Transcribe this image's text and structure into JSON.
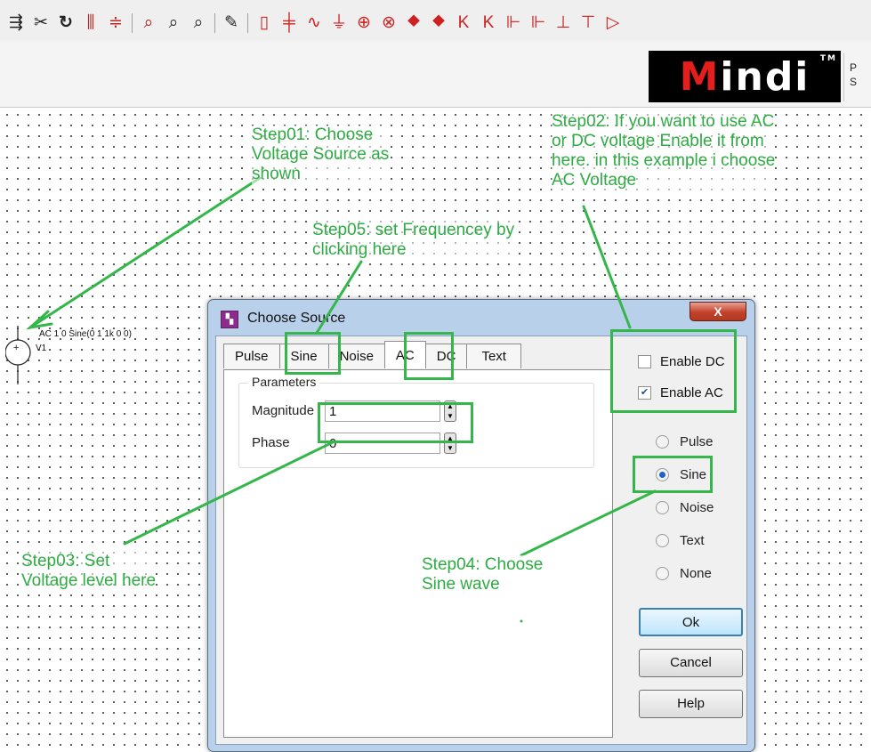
{
  "toolbar": {
    "icons": [
      "paste-icon",
      "cut-icon",
      "refresh-icon",
      "mirror-icon",
      "flip-icon",
      "zoom-fit-icon",
      "zoom-out-icon",
      "zoom-in-icon",
      "pencil-icon",
      "resistor-icon",
      "capacitor-icon",
      "wave-icon",
      "ground-icon",
      "voltage-source-icon",
      "current-source-icon",
      "diode-icon",
      "zener-diode-icon",
      "npn-transistor-icon",
      "pnp-transistor-icon",
      "nmos-icon",
      "pmos-icon",
      "jfet-n-icon",
      "jfet-p-icon",
      "opamp-icon"
    ]
  },
  "banner": {
    "logo_text": "Mindi",
    "logo_tm": "TM",
    "side_text": "P\nS"
  },
  "schematic": {
    "source_label": "AC 1 0 Sine(0 1 1k 0 0)",
    "source_name": "V1"
  },
  "annotations": {
    "step01": "Step01: Choose\nVoltage Source as\nshown",
    "step02": "Step02: If you want to use AC\nor DC voltage Enable it from\nhere. in this example i choose\nAC Voltage",
    "step03": "Step03: Set\nVoltage level here",
    "step04": "Step04: Choose\nSine wave",
    "step05": "Step05: set Frequencey by\nclicking here",
    "color": "#2eac43"
  },
  "dialog": {
    "title": "Choose Source",
    "close_label": "X",
    "tabs": [
      {
        "label": "Pulse"
      },
      {
        "label": "Sine"
      },
      {
        "label": "Noise"
      },
      {
        "label": "AC",
        "active": true
      },
      {
        "label": "DC"
      },
      {
        "label": "Text"
      }
    ],
    "parameters": {
      "title": "Parameters",
      "magnitude_label": "Magnitude",
      "magnitude_value": "1",
      "phase_label": "Phase",
      "phase_value": "0"
    },
    "checkboxes": {
      "enable_dc": {
        "label": "Enable DC",
        "checked": false
      },
      "enable_ac": {
        "label": "Enable AC",
        "checked": true
      }
    },
    "radios": [
      {
        "label": "Pulse",
        "selected": false
      },
      {
        "label": "Sine",
        "selected": true
      },
      {
        "label": "Noise",
        "selected": false
      },
      {
        "label": "Text",
        "selected": false
      },
      {
        "label": "None",
        "selected": false
      }
    ],
    "buttons": {
      "ok": "Ok",
      "cancel": "Cancel",
      "help": "Help"
    }
  }
}
